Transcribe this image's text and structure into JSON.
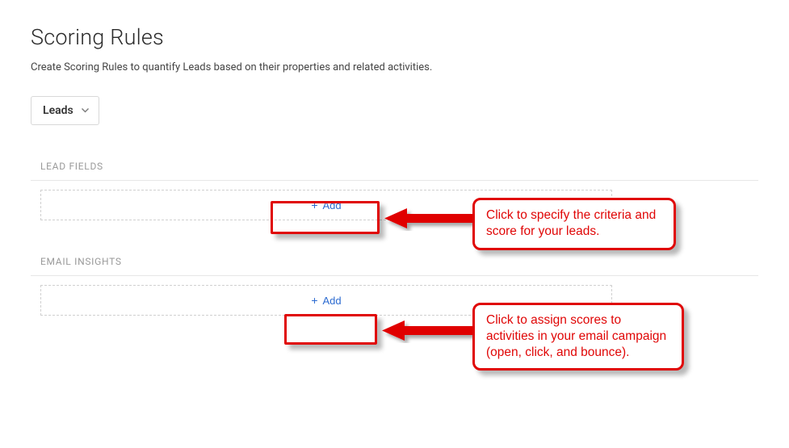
{
  "page": {
    "title": "Scoring Rules",
    "subtitle": "Create Scoring Rules to quantify Leads based on their properties and related activities."
  },
  "filter": {
    "selected": "Leads"
  },
  "sections": {
    "lead_fields": {
      "label": "LEAD FIELDS",
      "add_label": "Add"
    },
    "email_insights": {
      "label": "EMAIL INSIGHTS",
      "add_label": "Add"
    }
  },
  "annotations": {
    "callout1": "Click to specify the criteria and score for your leads.",
    "callout2": "Click to assign scores to activities in your email campaign (open, click, and bounce)."
  }
}
